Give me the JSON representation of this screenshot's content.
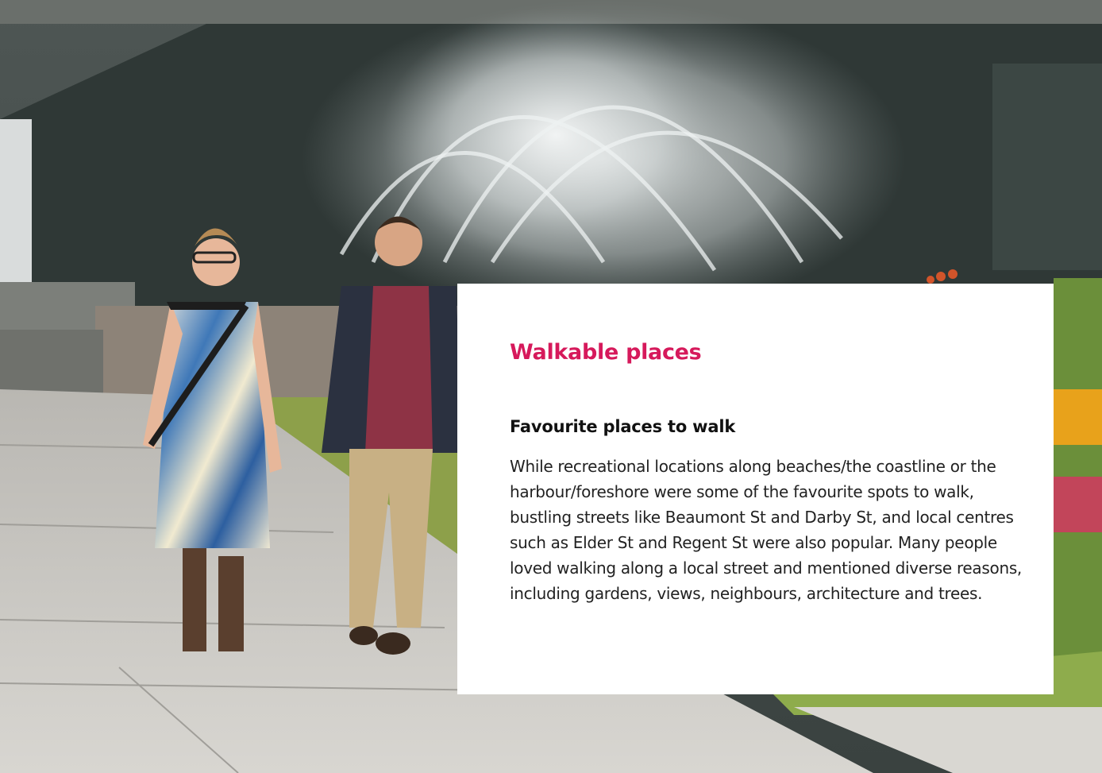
{
  "photo": {
    "subject_icon": "park-fountain-photo",
    "description_icon": "two-people-walking-photo"
  },
  "card": {
    "heading": "Walkable places",
    "subheading": "Favourite places to walk",
    "body": "While recreational locations along beaches/the coastline or the harbour/foreshore were some of the favourite spots to walk, bustling streets like Beaumont St and Darby St, and local centres such as Elder St and Regent St were also popular. Many people loved walking along a local street and mentioned diverse reasons, including gardens, views, neighbours, architecture and trees."
  },
  "colors": {
    "accent": "#d6195b",
    "card_background": "#ffffff",
    "text": "#222222"
  }
}
